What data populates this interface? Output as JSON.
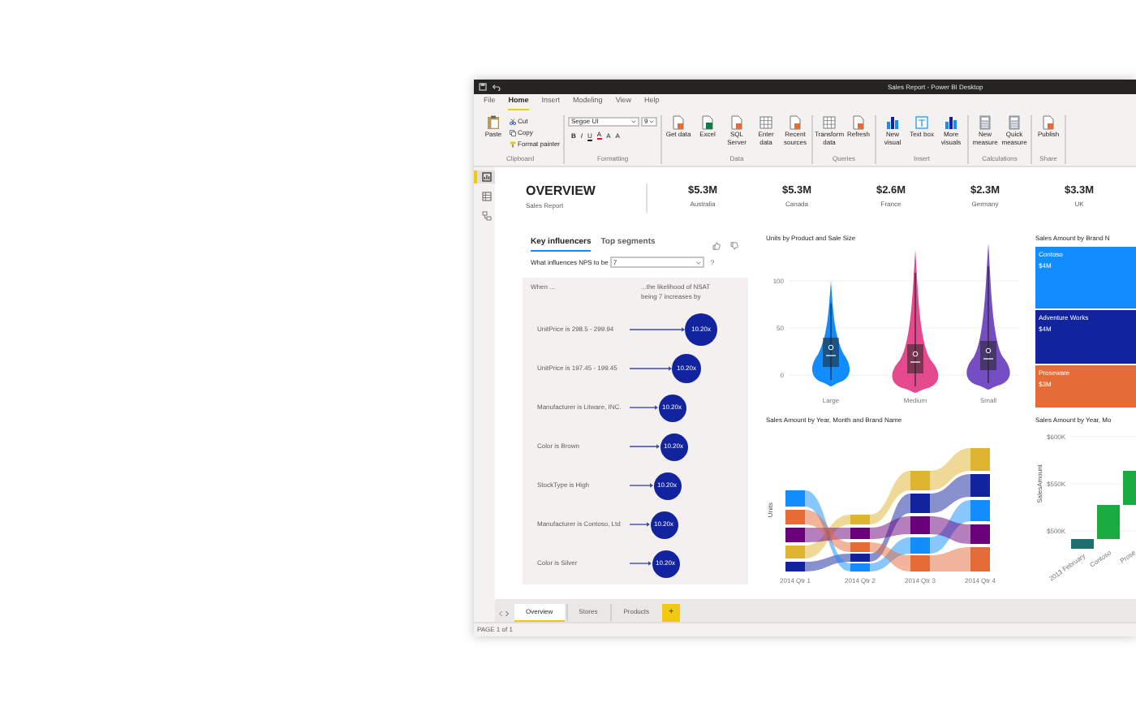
{
  "window": {
    "title": "Sales Report - Power BI Desktop"
  },
  "menu": [
    {
      "label": "File",
      "selected": false
    },
    {
      "label": "Home",
      "selected": true
    },
    {
      "label": "Insert",
      "selected": false
    },
    {
      "label": "Modeling",
      "selected": false
    },
    {
      "label": "View",
      "selected": false
    },
    {
      "label": "Help",
      "selected": false
    }
  ],
  "ribbon": [
    {
      "group": "Clipboard",
      "buttons": [
        {
          "kind": "large",
          "label": "Paste"
        },
        {
          "kind": "small",
          "label": "Cut"
        },
        {
          "kind": "small",
          "label": "Copy"
        },
        {
          "kind": "small",
          "label": "Format painter"
        }
      ]
    },
    {
      "group": "Formatting",
      "font": "Segoe UI",
      "size": "9",
      "buttons": [
        {
          "kind": "format",
          "label": "B"
        },
        {
          "kind": "format",
          "label": "I"
        },
        {
          "kind": "format",
          "label": "U"
        },
        {
          "kind": "format",
          "label": "A"
        },
        {
          "kind": "format",
          "label": "A"
        },
        {
          "kind": "format",
          "label": "A"
        }
      ]
    },
    {
      "group": "Data",
      "buttons": [
        {
          "kind": "large",
          "label": "Get data"
        },
        {
          "kind": "large",
          "label": "Excel"
        },
        {
          "kind": "large",
          "label": "SQL Server"
        },
        {
          "kind": "large",
          "label": "Enter data"
        },
        {
          "kind": "large",
          "label": "Recent sources"
        }
      ]
    },
    {
      "group": "Queries",
      "buttons": [
        {
          "kind": "large",
          "label": "Transform data"
        },
        {
          "kind": "large",
          "label": "Refresh"
        }
      ]
    },
    {
      "group": "Insert",
      "buttons": [
        {
          "kind": "large",
          "label": "New visual"
        },
        {
          "kind": "large",
          "label": "Text box"
        },
        {
          "kind": "large",
          "label": "More visuals"
        }
      ]
    },
    {
      "group": "Calculations",
      "buttons": [
        {
          "kind": "large",
          "label": "New measure"
        },
        {
          "kind": "large",
          "label": "Quick measure"
        }
      ]
    },
    {
      "group": "Share",
      "buttons": [
        {
          "kind": "large",
          "label": "Publish"
        }
      ]
    }
  ],
  "nav": [
    {
      "selected": true
    },
    {
      "selected": false
    },
    {
      "selected": false
    }
  ],
  "header": {
    "title": "OVERVIEW",
    "subtitle": "Sales Report"
  },
  "kpis": [
    {
      "value": "$5.3M",
      "label": "Australia"
    },
    {
      "value": "$5.3M",
      "label": "Canada"
    },
    {
      "value": "$2.6M",
      "label": "France"
    },
    {
      "value": "$2.3M",
      "label": "Germany"
    },
    {
      "value": "$3.3M",
      "label": "UK"
    }
  ],
  "key_influencers": {
    "tabs": [
      {
        "label": "Key influencers",
        "selected": true
      },
      {
        "label": "Top segments",
        "selected": false
      }
    ],
    "question": "What influences NPS to be",
    "answer": "7",
    "help": "?",
    "column_1": "When ...",
    "column_2": "...the likelihood of NSAT being 7 increases by",
    "rows": [
      {
        "label": "UnitPrice is 298.5 - 299.94",
        "value": "10.20x"
      },
      {
        "label": "UnitPrice is 197.45 - 199.45",
        "value": "10.20x"
      },
      {
        "label": "Manufacturer is Litware, INC.",
        "value": "10.20x"
      },
      {
        "label": "Color is Brown",
        "value": "10.20x"
      },
      {
        "label": "StockType is High",
        "value": "10.20x"
      },
      {
        "label": "Manufacturer is Contoso, Ltd",
        "value": "10.20x"
      },
      {
        "label": "Color is Silver",
        "value": "10.20x"
      }
    ]
  },
  "units_chart": {
    "title": "Units by Product and Sale Size",
    "yticks": [
      "100",
      "50",
      "0"
    ],
    "categories": [
      {
        "label": "Large",
        "color": "#118dff"
      },
      {
        "label": "Medium",
        "color": "#e44a8d"
      },
      {
        "label": "Small",
        "color": "#744ec2"
      }
    ]
  },
  "brand_treemap": {
    "title": "Sales Amount by Brand N",
    "tiles": [
      {
        "label": "Contoso",
        "value": "$4M",
        "color": "#118dff"
      },
      {
        "label": "Adventure Works",
        "value": "$4M",
        "color": "#12239e"
      },
      {
        "label": "Proseware",
        "value": "$3M",
        "color": "#e66c37"
      }
    ]
  },
  "ribbon_chart": {
    "title": "Sales Amount by Year, Month and Brand Name",
    "ylabel": "Units",
    "categories": [
      "2014 Qtr 1",
      "2014 Qtr 2",
      "2014 Qtr 3",
      "2014 Qtr 4"
    ]
  },
  "waterfall_chart": {
    "title": "Sales Amount by Year, Mo",
    "ylabel": "SalesAmount",
    "yticks": [
      "$600K",
      "$550K",
      "$500K"
    ],
    "categories": [
      "2013 February",
      "Contoso",
      "Prose"
    ]
  },
  "page_tabs": [
    {
      "label": "Overview",
      "selected": true
    },
    {
      "label": "Stores",
      "selected": false
    },
    {
      "label": "Products",
      "selected": false
    }
  ],
  "add_page": "+",
  "status_bar": "PAGE 1 of 1"
}
